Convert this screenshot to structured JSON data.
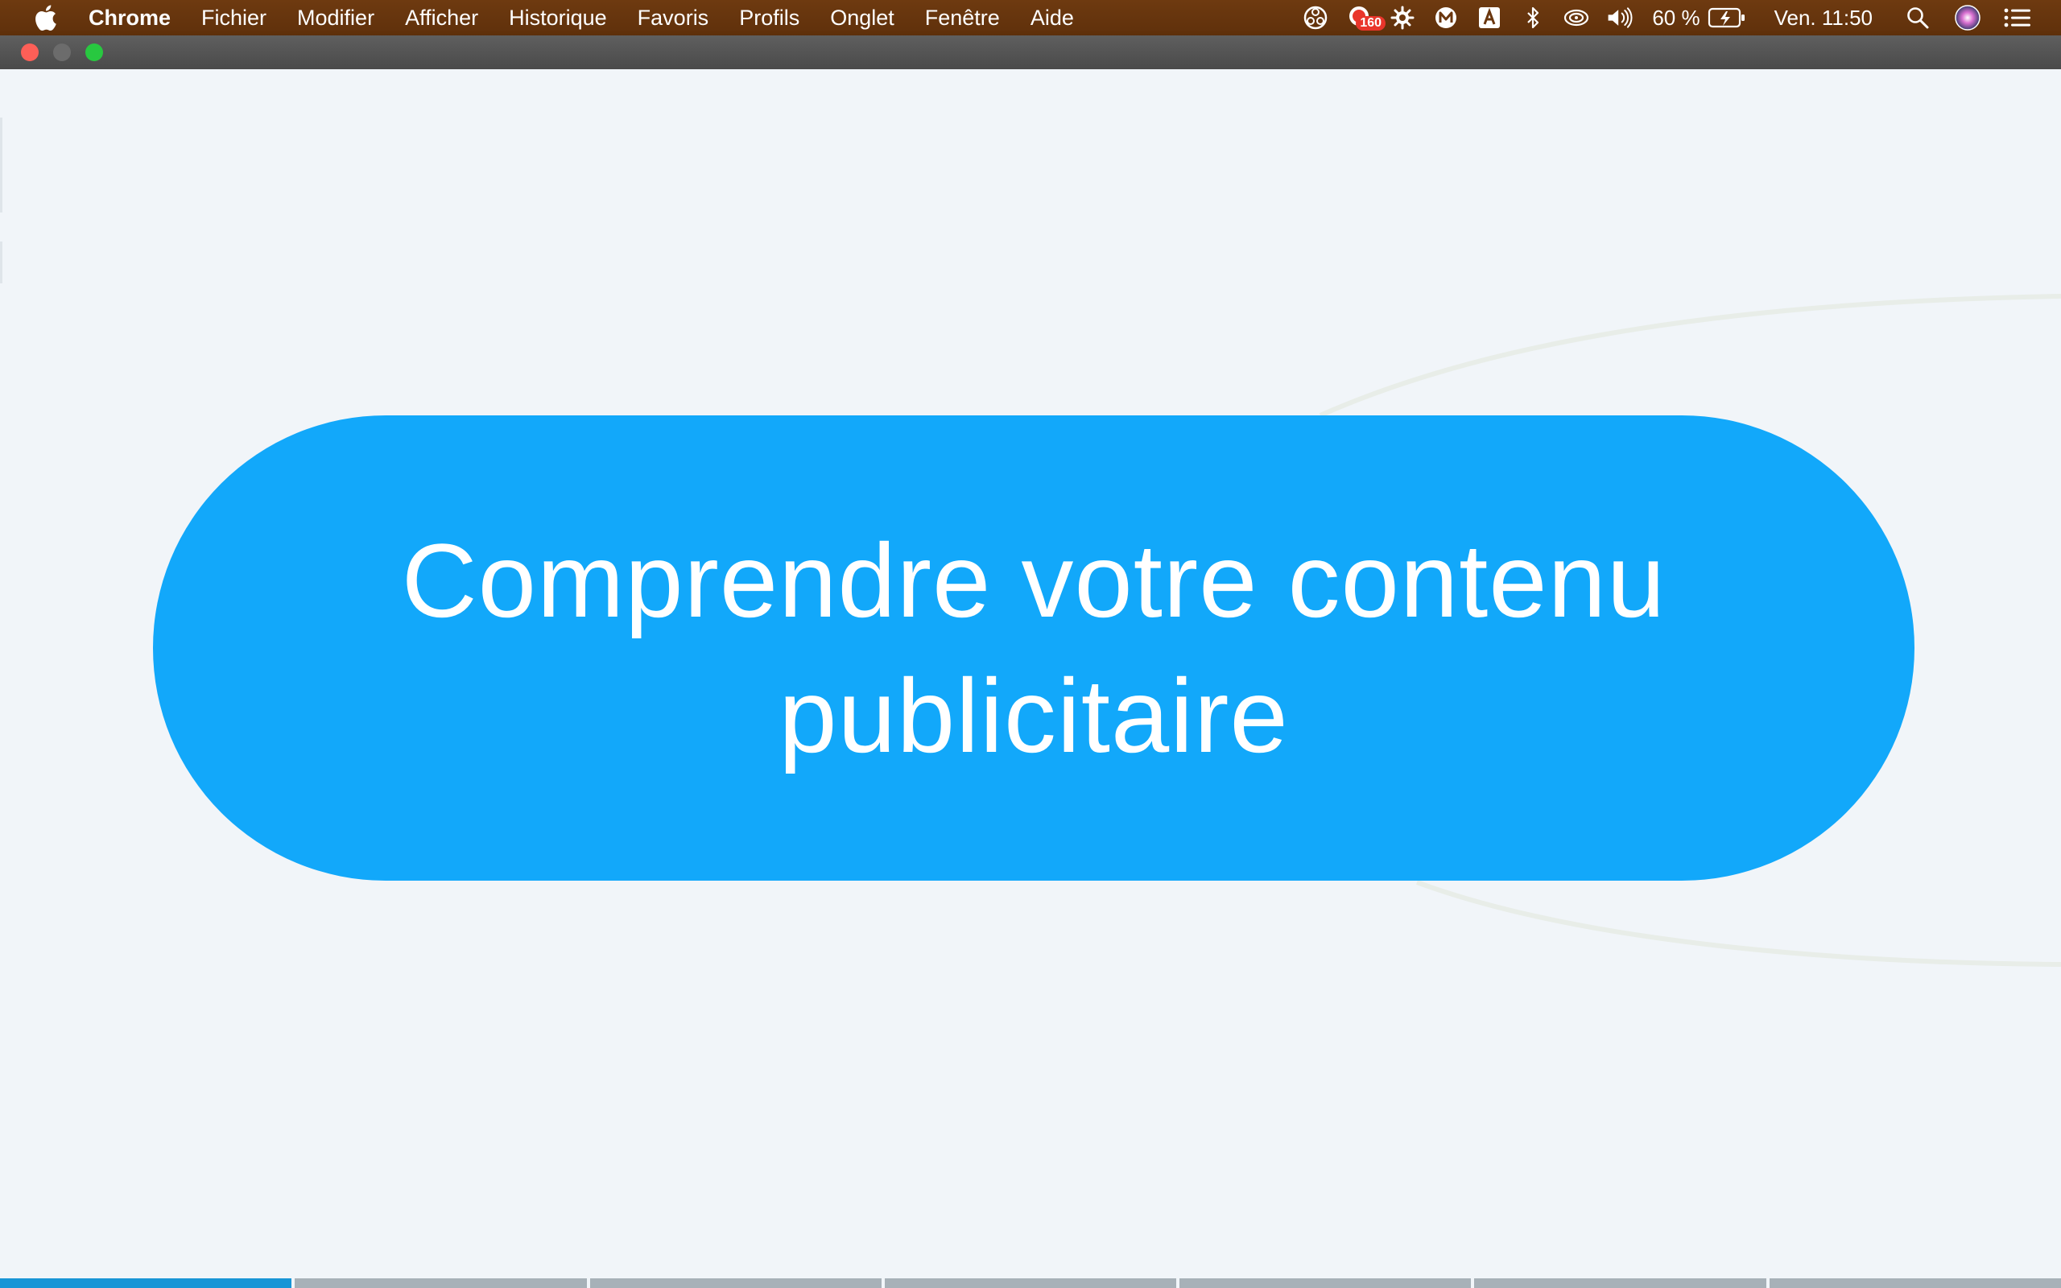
{
  "menubar": {
    "app_name": "Chrome",
    "menus": [
      "Fichier",
      "Modifier",
      "Afficher",
      "Historique",
      "Favoris",
      "Profils",
      "Onglet",
      "Fenêtre",
      "Aide"
    ],
    "notification_count": "160",
    "battery_percent": "60 %",
    "clock": "Ven. 11:50",
    "status_icons": [
      "obs-icon",
      "notification-icon",
      "gear-icon",
      "m-icon",
      "input-source-icon",
      "bluetooth-icon",
      "wifi-icon",
      "volume-icon",
      "battery-charging-icon",
      "spotlight-search-icon",
      "siri-icon",
      "notification-center-icon"
    ]
  },
  "window": {
    "buttons": [
      "close",
      "minimize",
      "maximize"
    ]
  },
  "slide": {
    "title": "Comprendre votre contenu publicitaire",
    "accent_color": "#12a8fa",
    "background_color": "#f1f5f9",
    "progress": {
      "total_segments": 7,
      "current_segment": 1
    }
  }
}
